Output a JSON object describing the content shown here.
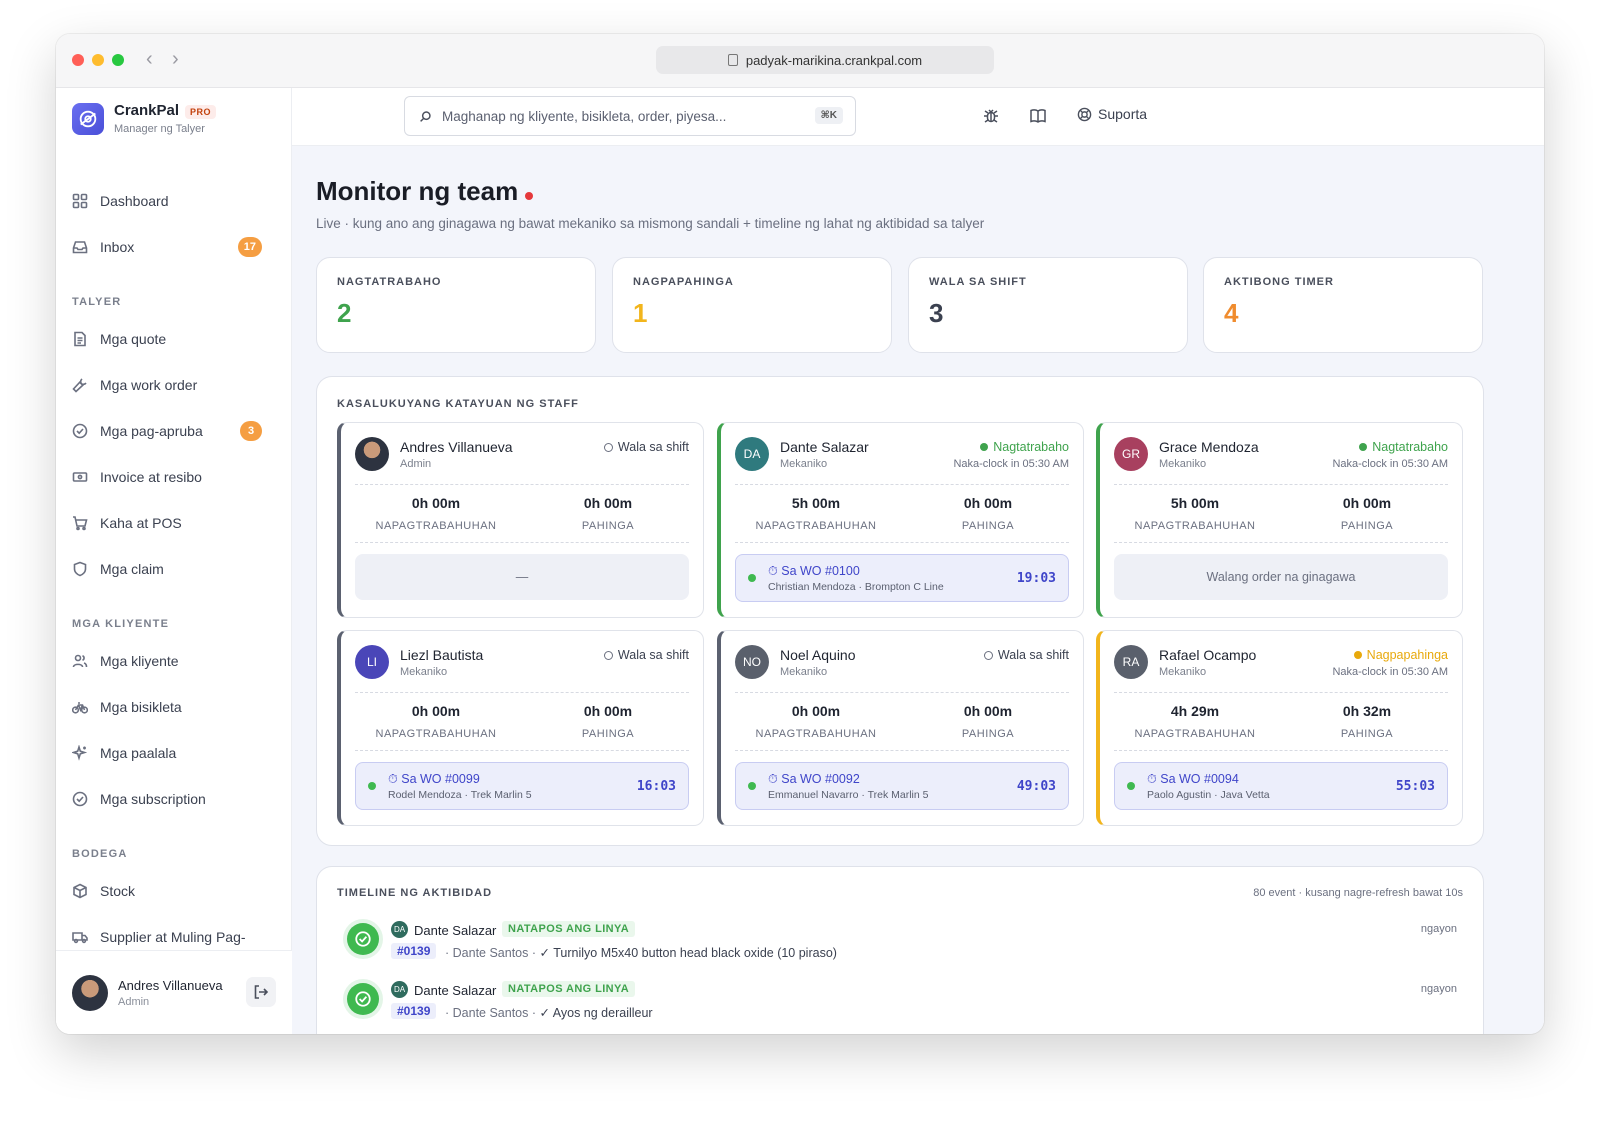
{
  "browser": {
    "url": "padyak-marikina.crankpal.com"
  },
  "brand": {
    "name": "CrankPal",
    "tier": "PRO",
    "subtitle": "Manager ng Talyer"
  },
  "search": {
    "placeholder": "Maghanap ng kliyente, bisikleta, order, piyesa...",
    "shortcut": "⌘K"
  },
  "topbar": {
    "support_label": "Suporta"
  },
  "sidebar": {
    "items": [
      {
        "label": "Dashboard",
        "icon": "grid-icon"
      },
      {
        "label": "Inbox",
        "icon": "inbox-icon",
        "badge": "17"
      }
    ],
    "sections": [
      {
        "title": "TALYER",
        "items": [
          {
            "label": "Mga quote",
            "icon": "document-icon"
          },
          {
            "label": "Mga work order",
            "icon": "wrench-icon"
          },
          {
            "label": "Mga pag-apruba",
            "icon": "check-circle-icon",
            "badge": "3"
          },
          {
            "label": "Invoice at resibo",
            "icon": "receipt-icon"
          },
          {
            "label": "Kaha at POS",
            "icon": "cart-icon"
          },
          {
            "label": "Mga claim",
            "icon": "shield-icon"
          }
        ]
      },
      {
        "title": "MGA KLIYENTE",
        "items": [
          {
            "label": "Mga kliyente",
            "icon": "users-icon"
          },
          {
            "label": "Mga bisikleta",
            "icon": "bike-icon"
          },
          {
            "label": "Mga paalala",
            "icon": "sparkle-icon"
          },
          {
            "label": "Mga subscription",
            "icon": "check-circle-icon"
          }
        ]
      },
      {
        "title": "BODEGA",
        "items": [
          {
            "label": "Stock",
            "icon": "box-icon"
          },
          {
            "label": "Supplier at Muling Pag-",
            "icon": "truck-icon"
          }
        ]
      }
    ],
    "user": {
      "name": "Andres Villanueva",
      "role": "Admin"
    }
  },
  "page": {
    "title": "Monitor ng team",
    "subtitle": "Live · kung ano ang ginagawa ng bawat mekaniko sa mismong sandali + timeline ng lahat ng aktibidad sa talyer"
  },
  "stats": [
    {
      "label": "NAGTATRABAHO",
      "value": "2",
      "color": "#3fa34d"
    },
    {
      "label": "NAGPAPAHINGA",
      "value": "1",
      "color": "#f2b51c"
    },
    {
      "label": "WALA SA SHIFT",
      "value": "3",
      "color": "#3b4150"
    },
    {
      "label": "AKTIBONG TIMER",
      "value": "4",
      "color": "#f08c2e"
    }
  ],
  "staff_panel": {
    "title": "KASALUKUYANG KATAYUAN NG STAFF",
    "worked_label": "NAPAGTRABAHUHAN",
    "break_label": "PAHINGA",
    "cards": [
      {
        "name": "Andres Villanueva",
        "role": "Admin",
        "initials": "",
        "avatar_color": "#2d3340",
        "status": "Wala sa shift",
        "status_type": "off",
        "clock": "",
        "worked": "0h 00m",
        "break": "0h 00m",
        "wo": null,
        "wo_empty": "—",
        "accent": "#5b6170"
      },
      {
        "name": "Dante Salazar",
        "role": "Mekaniko",
        "initials": "DA",
        "avatar_color": "#2f7a7e",
        "status": "Nagtatrabaho",
        "status_type": "working",
        "clock": "Naka-clock in 05:30 AM",
        "worked": "5h 00m",
        "break": "0h 00m",
        "wo": {
          "label": "Sa WO #0100",
          "detail": "Christian Mendoza · Brompton C Line",
          "timer": "19:03"
        },
        "accent": "#3fa34d"
      },
      {
        "name": "Grace Mendoza",
        "role": "Mekaniko",
        "initials": "GR",
        "avatar_color": "#a8405f",
        "status": "Nagtatrabaho",
        "status_type": "working",
        "clock": "Naka-clock in 05:30 AM",
        "worked": "5h 00m",
        "break": "0h 00m",
        "wo": null,
        "wo_empty": "Walang order na ginagawa",
        "accent": "#3fa34d"
      },
      {
        "name": "Liezl Bautista",
        "role": "Mekaniko",
        "initials": "LI",
        "avatar_color": "#4a46b8",
        "status": "Wala sa shift",
        "status_type": "off",
        "clock": "",
        "worked": "0h 00m",
        "break": "0h 00m",
        "wo": {
          "label": "Sa WO #0099",
          "detail": "Rodel Mendoza · Trek Marlin 5",
          "timer": "16:03"
        },
        "accent": "#5b6170"
      },
      {
        "name": "Noel Aquino",
        "role": "Mekaniko",
        "initials": "NO",
        "avatar_color": "#5a606c",
        "status": "Wala sa shift",
        "status_type": "off",
        "clock": "",
        "worked": "0h 00m",
        "break": "0h 00m",
        "wo": {
          "label": "Sa WO #0092",
          "detail": "Emmanuel Navarro · Trek Marlin 5",
          "timer": "49:03"
        },
        "accent": "#5b6170"
      },
      {
        "name": "Rafael Ocampo",
        "role": "Mekaniko",
        "initials": "RA",
        "avatar_color": "#5a606c",
        "status": "Nagpapahinga",
        "status_type": "break",
        "clock": "Naka-clock in 05:30 AM",
        "worked": "4h 29m",
        "break": "0h 32m",
        "wo": {
          "label": "Sa WO #0094",
          "detail": "Paolo Agustin · Java Vetta",
          "timer": "55:03"
        },
        "accent": "#f2b51c"
      }
    ]
  },
  "timeline": {
    "title": "TIMELINE NG AKTIBIDAD",
    "meta": "80 event · kusang nagre-refresh bawat 10s",
    "events": [
      {
        "initials": "DA",
        "name": "Dante Salazar",
        "tag": "NATAPOS ANG LINYA",
        "wo": "#0139",
        "customer": "· Dante Santos ·",
        "text": "✓ Turnilyo M5x40 button head black oxide (10 piraso)",
        "time": "ngayon"
      },
      {
        "initials": "DA",
        "name": "Dante Salazar",
        "tag": "NATAPOS ANG LINYA",
        "wo": "#0139",
        "customer": "· Dante Santos ·",
        "text": "✓ Ayos ng derailleur",
        "time": "ngayon"
      }
    ]
  }
}
